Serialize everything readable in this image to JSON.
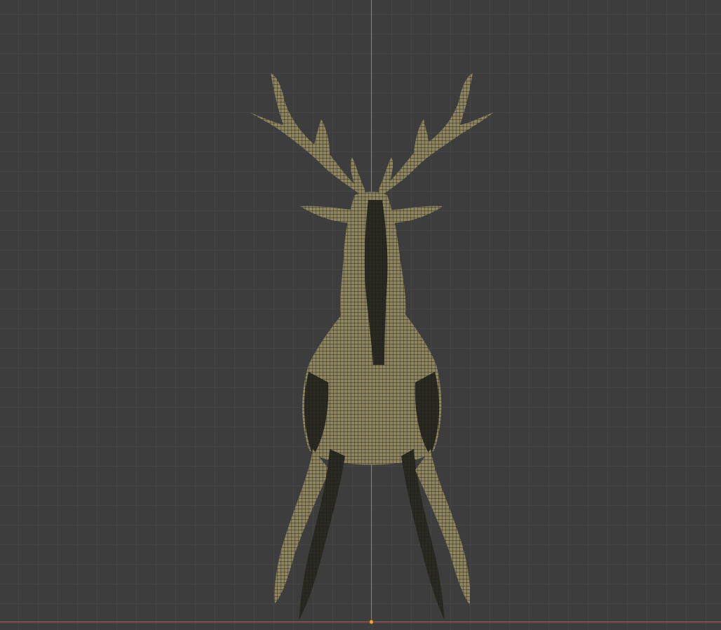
{
  "viewport": {
    "background_color": "#3d3d3d",
    "grid_color": "#4a4a4a",
    "axis_y_color": "#5a86c7",
    "axis_x_color": "#b85a5a",
    "origin_color": "#f2a440"
  },
  "object": {
    "icon": "deer-mesh-icon",
    "mesh_color": "#8f8660",
    "shadow_color": "#1e1e1a"
  }
}
